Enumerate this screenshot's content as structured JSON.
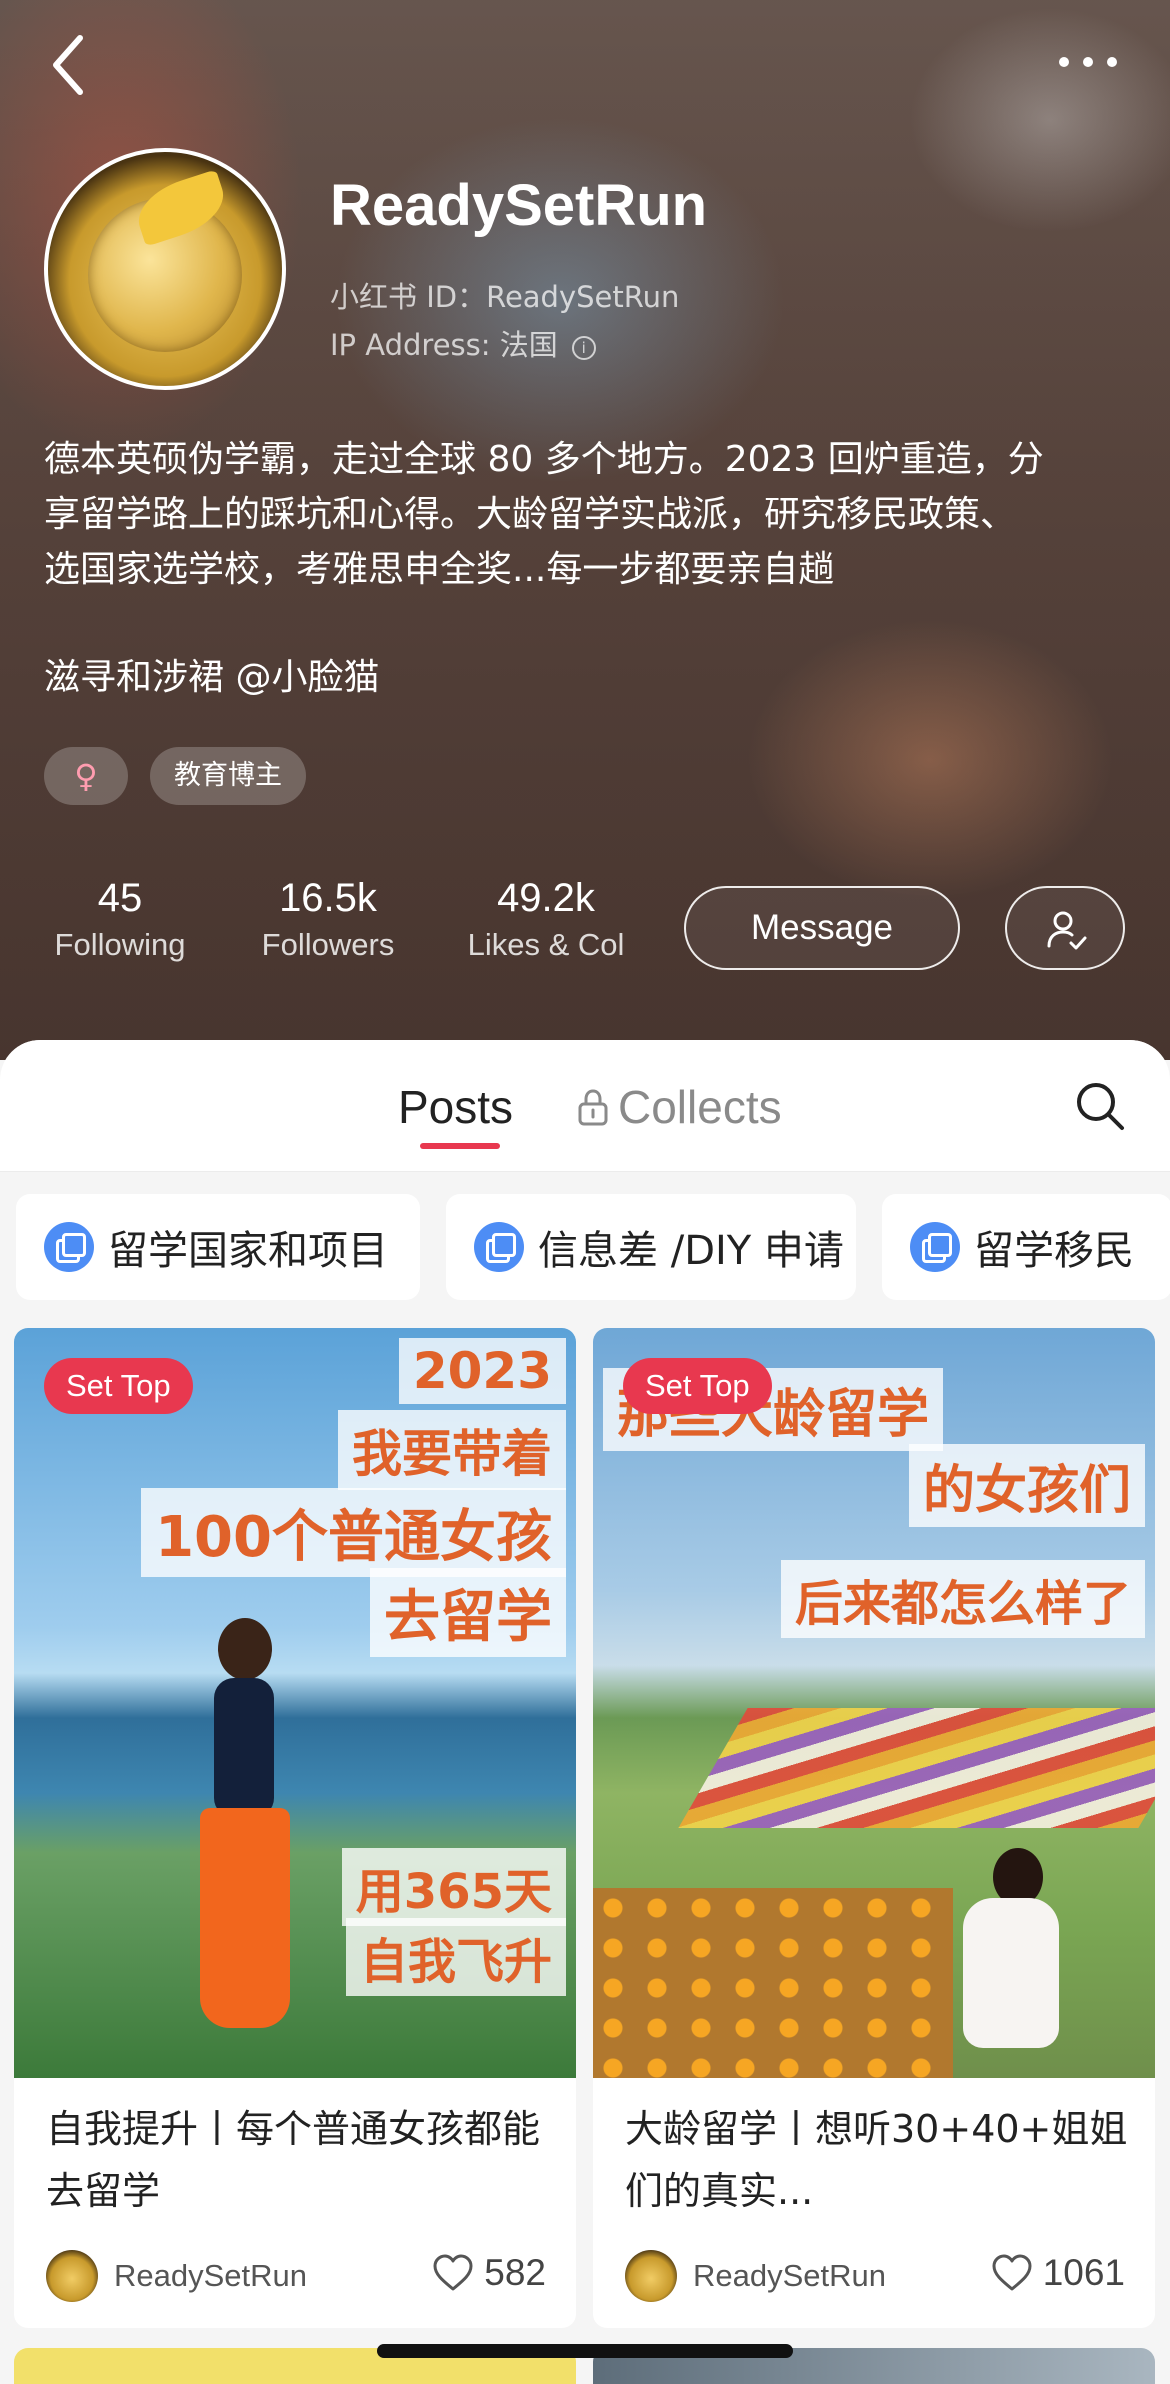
{
  "profile": {
    "username": "ReadySetRun",
    "xhs_id": "小红书 ID：ReadySetRun",
    "ip_address": "IP Address: 法国",
    "info_glyph": "i",
    "bio_line1": "德本英硕伪学霸，走过全球 80 多个地方。2023 回炉重造，分",
    "bio_line2": "享留学路上的踩坑和心得。大龄留学实战派，研究移民政策、",
    "bio_line3": "选国家选学校，考雅思申全奖...每一步都要亲自趟",
    "bio_line4": "滋寻和涉裙 @小脸猫",
    "tags": [
      {
        "label": "♀"
      },
      {
        "label": "教育博主"
      }
    ]
  },
  "stats": {
    "following_count": "45",
    "following_label": "Following",
    "followers_count": "16.5k",
    "followers_label": "Followers",
    "likes_count": "49.2k",
    "likes_label": "Likes & Col"
  },
  "actions": {
    "message_label": "Message"
  },
  "tabs": {
    "posts": "Posts",
    "collects": "Collects"
  },
  "albums": [
    {
      "label": "留学国家和项目"
    },
    {
      "label": "信息差 /DIY 申请"
    },
    {
      "label": "留学移民"
    }
  ],
  "posts": [
    {
      "badge": "Set Top",
      "cover_text": [
        "2023",
        "我要带着",
        "100个普通女孩",
        "去留学",
        "用365天",
        "自我飞升"
      ],
      "title": "自我提升丨每个普通女孩都能去留学",
      "author": "ReadySetRun",
      "likes": "582"
    },
    {
      "badge": "Set Top",
      "cover_text": [
        "那些大龄留学",
        "的女孩们",
        "后来都怎么样了"
      ],
      "title": "大龄留学丨想听30+40+姐姐们的真实...",
      "author": "ReadySetRun",
      "likes": "1061"
    }
  ],
  "colors": {
    "accent": "#e8384f",
    "album_icon": "#4d8df5",
    "cover_text": "#e0622a"
  }
}
